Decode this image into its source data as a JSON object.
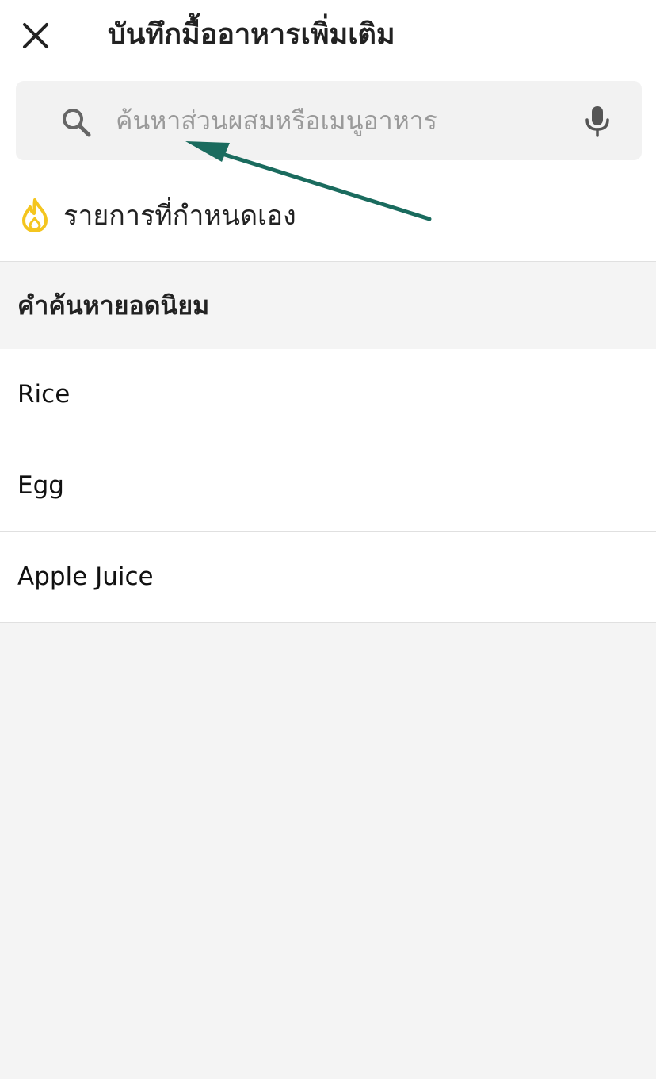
{
  "header": {
    "title": "บันทึกมื้ออาหารเพิ่มเติม",
    "close_icon": "close-icon"
  },
  "search": {
    "placeholder": "ค้นหาส่วนผสมหรือเมนูอาหาร",
    "value": "",
    "search_icon": "search-icon",
    "mic_icon": "microphone-icon"
  },
  "custom_entry": {
    "label": "รายการที่กำหนดเอง",
    "icon": "flame-icon",
    "icon_color": "#f4c51f"
  },
  "popular": {
    "title": "คำค้นหายอดนิยม",
    "items": [
      {
        "label": "Rice"
      },
      {
        "label": "Egg"
      },
      {
        "label": "Apple Juice"
      }
    ]
  },
  "colors": {
    "annotation_arrow": "#1a6b5e",
    "background": "#f4f4f4"
  }
}
